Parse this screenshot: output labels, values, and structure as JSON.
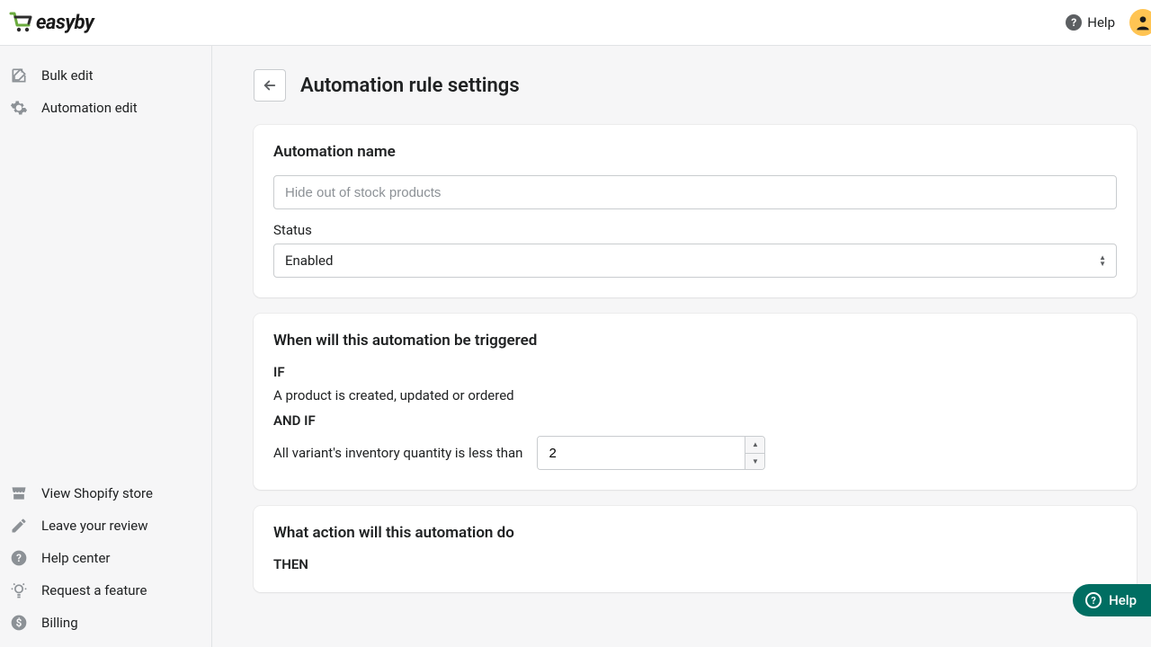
{
  "brand": {
    "name": "easyby"
  },
  "topbar": {
    "help_label": "Help"
  },
  "sidebar": {
    "top": [
      {
        "label": "Bulk edit",
        "icon": "edit-icon"
      },
      {
        "label": "Automation edit",
        "icon": "gear-icon"
      }
    ],
    "bottom": [
      {
        "label": "View Shopify store",
        "icon": "store-icon"
      },
      {
        "label": "Leave your review",
        "icon": "pencil-icon"
      },
      {
        "label": "Help center",
        "icon": "question-circle-icon"
      },
      {
        "label": "Request a feature",
        "icon": "lightbulb-icon"
      },
      {
        "label": "Billing",
        "icon": "dollar-circle-icon"
      }
    ]
  },
  "page": {
    "title": "Automation rule settings"
  },
  "cards": {
    "name": {
      "heading": "Automation name",
      "placeholder": "Hide out of stock products",
      "value": "",
      "status_label": "Status",
      "status_value": "Enabled"
    },
    "trigger": {
      "heading": "When will this automation be triggered",
      "if_label": "IF",
      "if_text": "A product is created, updated or ordered",
      "andif_label": "AND IF",
      "andif_text": "All variant's inventory quantity is less than",
      "threshold": "2"
    },
    "action": {
      "heading": "What action will this automation do",
      "then_label": "THEN"
    }
  },
  "fab": {
    "label": "Help"
  }
}
